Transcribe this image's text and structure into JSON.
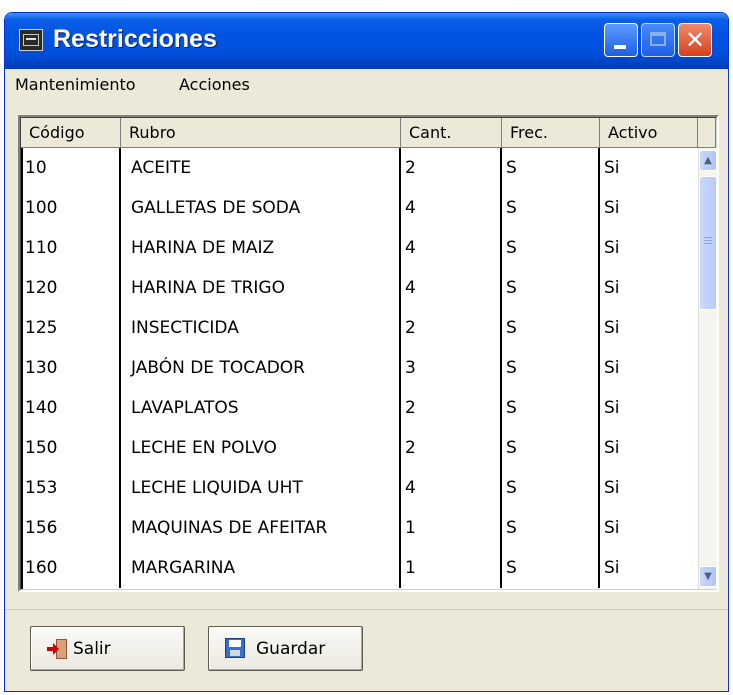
{
  "window": {
    "title": "Restricciones"
  },
  "menu": {
    "items": [
      "Mantenimiento",
      "Acciones"
    ]
  },
  "table": {
    "headers": [
      "Código",
      "Rubro",
      "Cant.",
      "Frec.",
      "Activo"
    ],
    "rows": [
      [
        "10",
        "ACEITE",
        "2",
        "S",
        "Si"
      ],
      [
        "100",
        "GALLETAS DE SODA",
        "4",
        "S",
        "Si"
      ],
      [
        "110",
        "HARINA DE MAIZ",
        "4",
        "S",
        "Si"
      ],
      [
        "120",
        "HARINA DE TRIGO",
        "4",
        "S",
        "Si"
      ],
      [
        "125",
        "INSECTICIDA",
        "2",
        "S",
        "Si"
      ],
      [
        "130",
        "JABÓN DE TOCADOR",
        "3",
        "S",
        "Si"
      ],
      [
        "140",
        "LAVAPLATOS",
        "2",
        "S",
        "Si"
      ],
      [
        "150",
        "LECHE EN POLVO",
        "2",
        "S",
        "Si"
      ],
      [
        "153",
        "LECHE LIQUIDA UHT",
        "4",
        "S",
        "Si"
      ],
      [
        "156",
        "MAQUINAS DE AFEITAR",
        "1",
        "S",
        "Si"
      ],
      [
        "160",
        "MARGARINA",
        "1",
        "S",
        "Si"
      ]
    ]
  },
  "buttons": {
    "exit_label": "Salir",
    "save_label": "Guardar"
  },
  "icons": {
    "app": "app-icon",
    "minimize": "minimize-icon",
    "maximize": "maximize-icon",
    "close": "close-icon",
    "exit": "exit-door-icon",
    "save": "floppy-disk-icon"
  },
  "colors": {
    "titlebar": "#0054e3",
    "close_button": "#d7401e",
    "window_bg": "#ece9d8"
  }
}
